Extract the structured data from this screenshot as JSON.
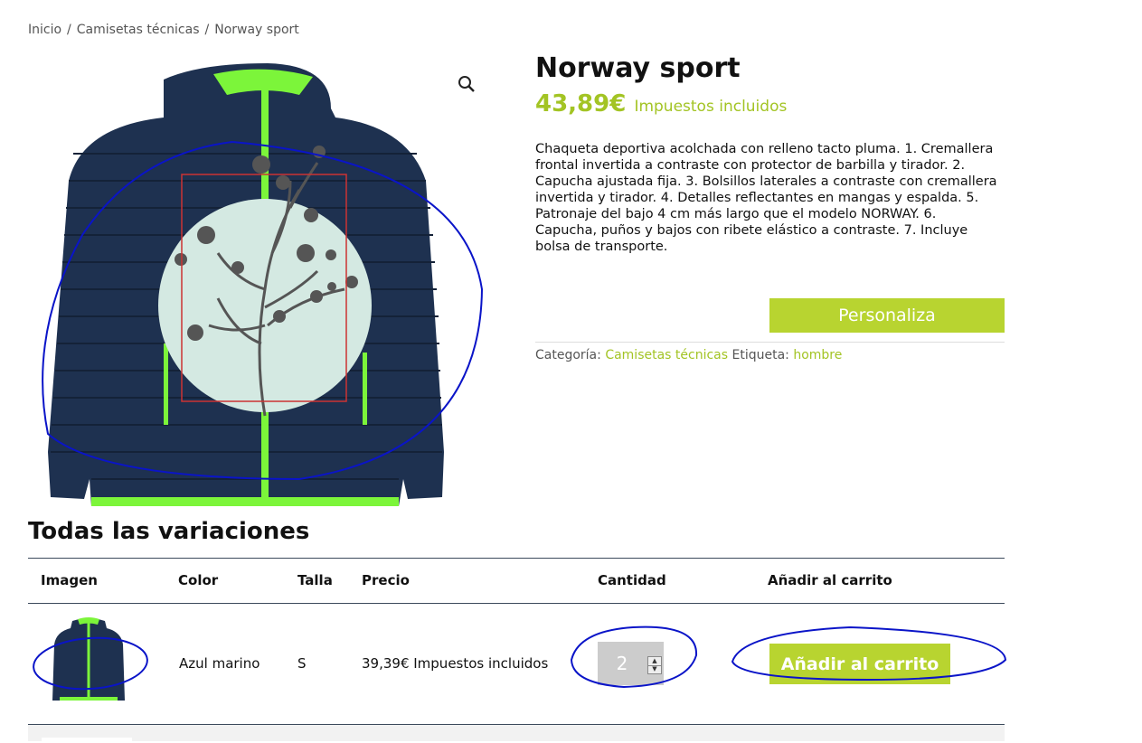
{
  "breadcrumb": {
    "items": [
      "Inicio",
      "Camisetas técnicas",
      "Norway sport"
    ],
    "separator": "/"
  },
  "product": {
    "title": "Norway sport",
    "price": "43,89€",
    "tax_note": "Impuestos incluidos",
    "description": "Chaqueta deportiva acolchada con relleno tacto pluma. 1. Cremallera frontal invertida a contraste con protector de barbilla y tirador. 2. Capucha ajustada fija. 3. Bolsillos laterales a contraste con cremallera invertida y tirador. 4. Detalles reflectantes en mangas y espalda. 5. Patronaje del bajo 4 cm más largo que el modelo NORWAY. 6. Capucha, puños y bajos con ribete elástico a contraste. 7. Incluye bolsa de transporte.",
    "customize_button": "Personaliza",
    "category_label": "Categoría:",
    "category_value": "Camisetas técnicas",
    "tag_label": "Etiqueta:",
    "tag_value": "hombre",
    "zoom_icon": "magnifier-icon"
  },
  "variations": {
    "heading": "Todas las variaciones",
    "columns": [
      "Imagen",
      "Color",
      "Talla",
      "Precio",
      "Cantidad",
      "Añadir al carrito"
    ],
    "rows": [
      {
        "color": "Azul marino",
        "size": "S",
        "price": "39,39€ Impuestos incluidos",
        "quantity": "2",
        "add_button": "Añadir al carrito"
      }
    ]
  },
  "colors": {
    "accent": "#b8d430",
    "price": "#a3c424",
    "jacket": "#1e3150",
    "zip": "#7cf53a",
    "circle": "#d4e9e2",
    "annotation_ink": "#0a14c8",
    "annotation_box": "#cc3333"
  }
}
